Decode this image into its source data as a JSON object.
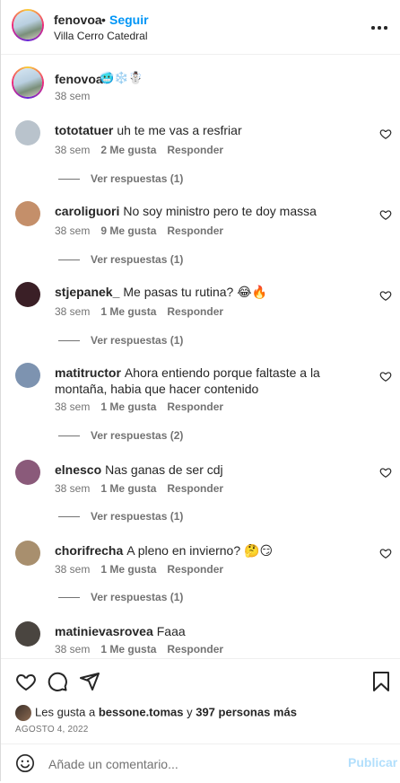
{
  "header": {
    "username": "fenovoa",
    "separator": "•",
    "follow_label": "Seguir",
    "location": "Villa Cerro Catedral",
    "more_icon": "more-options-icon"
  },
  "caption": {
    "username": "fenovoa",
    "emoji": "🥶❄️☃️",
    "time": "38 sem"
  },
  "comments": [
    {
      "user": "tototatuer",
      "text": "uh te me vas a resfriar",
      "time": "38 sem",
      "likes": "2 Me gusta",
      "reply": "Responder",
      "replies": "Ver respuestas (1)",
      "avatar_color": "#b9c3cc"
    },
    {
      "user": "caroliguori",
      "text": "No soy ministro pero te doy massa",
      "time": "38 sem",
      "likes": "9 Me gusta",
      "reply": "Responder",
      "replies": "Ver respuestas (1)",
      "avatar_color": "#c48f6a"
    },
    {
      "user": "stjepanek_",
      "text": "Me pasas tu rutina? 😂🔥",
      "time": "38 sem",
      "likes": "1 Me gusta",
      "reply": "Responder",
      "replies": "Ver respuestas (1)",
      "avatar_color": "#3a1f26"
    },
    {
      "user": "matitructor",
      "text": "Ahora entiendo porque faltaste a la montaña, habia que hacer contenido",
      "time": "38 sem",
      "likes": "1 Me gusta",
      "reply": "Responder",
      "replies": "Ver respuestas (2)",
      "avatar_color": "#7d93b0"
    },
    {
      "user": "elnesco",
      "text": "Nas ganas de ser cdj",
      "time": "38 sem",
      "likes": "1 Me gusta",
      "reply": "Responder",
      "replies": "Ver respuestas (1)",
      "avatar_color": "#8a5a7a"
    },
    {
      "user": "chorifrecha",
      "text": "A pleno en invierno? 🤔😏",
      "time": "38 sem",
      "likes": "1 Me gusta",
      "reply": "Responder",
      "replies": "Ver respuestas (1)",
      "avatar_color": "#a88f6e"
    },
    {
      "user": "matinievasrovea",
      "text": "Faaa",
      "time": "38 sem",
      "likes": "1 Me gusta",
      "reply": "Responder",
      "replies": "",
      "avatar_color": "#4a4540"
    }
  ],
  "actions": {
    "like_icon": "heart-icon",
    "comment_icon": "comment-icon",
    "share_icon": "share-icon",
    "save_icon": "bookmark-icon"
  },
  "likes": {
    "prefix": "Les gusta a ",
    "user": "bessone.tomas",
    "middle": " y ",
    "others": "397 personas más"
  },
  "date": "AGOSTO 4, 2022",
  "add_comment": {
    "placeholder": "Añade un comentario...",
    "post_label": "Publicar"
  }
}
